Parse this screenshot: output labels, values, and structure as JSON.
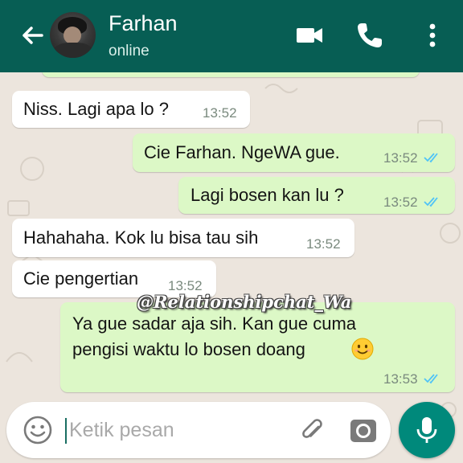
{
  "header": {
    "contact_name": "Farhan",
    "contact_status": "online",
    "background_color": "#075e54"
  },
  "messages": [
    {
      "direction": "incoming",
      "text": "Niss. Lagi apa lo ?",
      "time": "13:52"
    },
    {
      "direction": "outgoing",
      "text": "Cie Farhan. NgeWA gue.",
      "time": "13:52",
      "status": "read"
    },
    {
      "direction": "outgoing",
      "text": "Lagi bosen kan lu ?",
      "time": "13:52",
      "status": "read"
    },
    {
      "direction": "incoming",
      "text": "Hahahaha. Kok lu bisa tau sih",
      "time": "13:52"
    },
    {
      "direction": "incoming",
      "text": "Cie pengertian",
      "time": "13:52"
    },
    {
      "direction": "outgoing",
      "text_line1": "Ya gue sadar aja sih. Kan gue cuma",
      "text_line2": "pengisi waktu lo bosen doang",
      "emoji": "smiling-face-emoji",
      "time": "13:53",
      "status": "read"
    }
  ],
  "watermark": "@Relationshipchat_Wa",
  "composer": {
    "placeholder": "Ketik pesan"
  },
  "icons": {
    "back": "arrow-left-icon",
    "video": "video-camera-icon",
    "call": "phone-icon",
    "menu": "more-vertical-icon",
    "emoji": "emoji-icon",
    "attach": "paperclip-icon",
    "camera": "camera-icon",
    "mic": "microphone-icon"
  },
  "colors": {
    "incoming_bubble": "#ffffff",
    "outgoing_bubble": "#dcf8c6",
    "read_ticks": "#4fc3f7",
    "mic_button": "#00897b"
  }
}
